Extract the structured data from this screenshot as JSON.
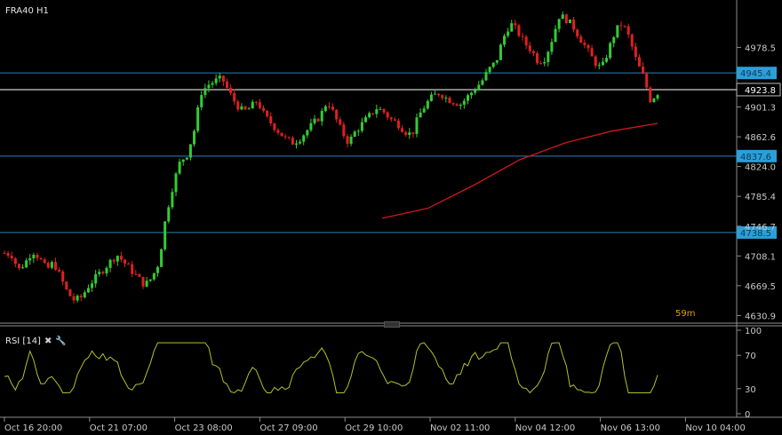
{
  "symbol_label": "FRA40 H1",
  "bar_timer": "59m",
  "rsi_panel": {
    "label": "RSI [14]",
    "close_icon": "✖",
    "settings_icon": "🔧"
  },
  "colors": {
    "background": "#000000",
    "bull": "#33cc33",
    "bear": "#e02020",
    "ma": "#d01818",
    "support_lines": "#2a7fb8",
    "price_line": "#ffffff",
    "rsi": "#b5bf2b",
    "axis_text": "#c8c8c8",
    "tag_bg": "#2a9fd8"
  },
  "chart_data": {
    "type": "candlestick",
    "price_axis_ticks": [
      "4978.5",
      "4901.3",
      "4862.6",
      "4824.0",
      "4785.4",
      "4746.7",
      "4708.1",
      "4669.5",
      "4630.9"
    ],
    "y_range": [
      4621,
      5040
    ],
    "horizontal_levels": [
      {
        "price": 4945.4,
        "tag": "4945.4"
      },
      {
        "price": 4837.6,
        "tag": "4837.6"
      },
      {
        "price": 4738.5,
        "tag": "4738.5"
      }
    ],
    "current_price": "4923.8",
    "time_labels": [
      "Oct 16 20:00",
      "Oct 21 07:00",
      "Oct 23 08:00",
      "Oct 27 09:00",
      "Oct 29 10:00",
      "Nov 02 11:00",
      "Nov 04 12:00",
      "Nov 06 13:00",
      "Nov 10 04:00"
    ],
    "close_path": [
      4712,
      4710,
      4690,
      4700,
      4715,
      4705,
      4690,
      4700,
      4680,
      4660,
      4650,
      4655,
      4670,
      4680,
      4690,
      4700,
      4710,
      4700,
      4690,
      4680,
      4670,
      4680,
      4700,
      4760,
      4800,
      4830,
      4840,
      4870,
      4920,
      4930,
      4935,
      4938,
      4920,
      4905,
      4895,
      4900,
      4910,
      4890,
      4880,
      4870,
      4860,
      4855,
      4860,
      4870,
      4880,
      4890,
      4910,
      4890,
      4870,
      4855,
      4870,
      4880,
      4890,
      4900,
      4895,
      4885,
      4880,
      4870,
      4865,
      4890,
      4905,
      4915,
      4920,
      4912,
      4908,
      4905,
      4915,
      4925,
      4935,
      4950,
      4960,
      4990,
      5010,
      5000,
      4985,
      4975,
      4960,
      4965,
      4990,
      5020,
      5015,
      5005,
      4990,
      4975,
      4960,
      4950,
      4975,
      5000,
      5010,
      4990,
      4960,
      4940,
      4910,
      4920
    ],
    "ma_points": [
      [
        4757,
        0.49
      ],
      [
        4770,
        0.54
      ],
      [
        4800,
        0.61
      ],
      [
        4833,
        0.67
      ],
      [
        4855,
        0.72
      ],
      [
        4870,
        0.78
      ],
      [
        4880,
        0.84
      ]
    ],
    "rsi": {
      "levels": [
        "100",
        "70",
        "30",
        "0"
      ],
      "level_values": [
        100,
        70,
        30,
        0
      ],
      "range": [
        0,
        100
      ]
    }
  }
}
